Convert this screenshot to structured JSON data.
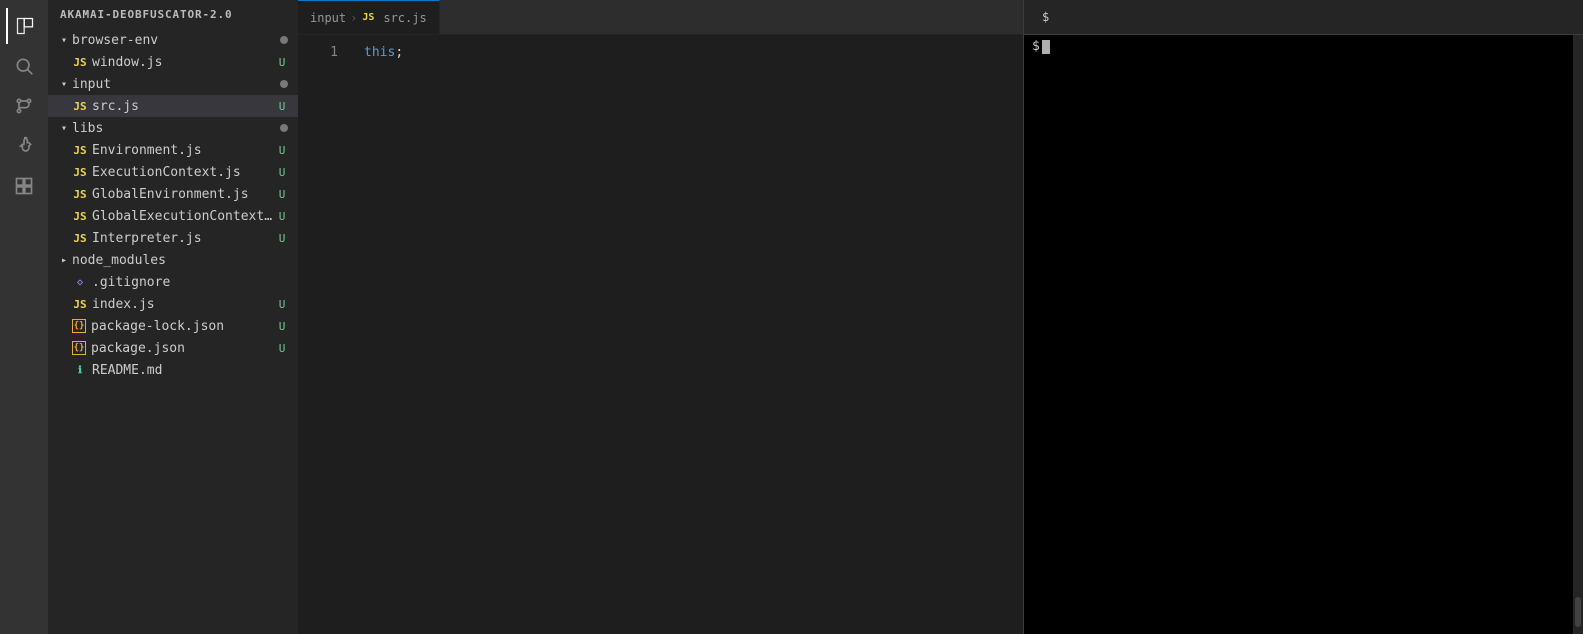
{
  "app": {
    "title": "AKAMAI-DEOBFUSCATOR-2.0"
  },
  "sidebar": {
    "header": "AKAMAI-DEOBFUSCATOR-2.0",
    "items": [
      {
        "id": "browser-env",
        "type": "folder",
        "label": "browser-env",
        "depth": 0,
        "expanded": true,
        "badge": "dot"
      },
      {
        "id": "window-js",
        "type": "js",
        "label": "window.js",
        "depth": 1,
        "badge": "U"
      },
      {
        "id": "input",
        "type": "folder",
        "label": "input",
        "depth": 0,
        "expanded": true,
        "badge": "dot"
      },
      {
        "id": "src-js",
        "type": "js",
        "label": "src.js",
        "depth": 1,
        "badge": "U",
        "active": true
      },
      {
        "id": "libs",
        "type": "folder",
        "label": "libs",
        "depth": 0,
        "expanded": true,
        "badge": "dot"
      },
      {
        "id": "environment-js",
        "type": "js",
        "label": "Environment.js",
        "depth": 1,
        "badge": "U"
      },
      {
        "id": "executioncontext-js",
        "type": "js",
        "label": "ExecutionContext.js",
        "depth": 1,
        "badge": "U"
      },
      {
        "id": "globalenvironment-js",
        "type": "js",
        "label": "GlobalEnvironment.js",
        "depth": 1,
        "badge": "U"
      },
      {
        "id": "globalexecutioncontext-js",
        "type": "js",
        "label": "GlobalExecutionContext.js",
        "depth": 1,
        "badge": "U"
      },
      {
        "id": "interpreter-js",
        "type": "js",
        "label": "Interpreter.js",
        "depth": 1,
        "badge": "U"
      },
      {
        "id": "node-modules",
        "type": "folder",
        "label": "node_modules",
        "depth": 0,
        "expanded": false,
        "badge": ""
      },
      {
        "id": "gitignore",
        "type": "git",
        "label": ".gitignore",
        "depth": 0,
        "badge": ""
      },
      {
        "id": "index-js",
        "type": "js",
        "label": "index.js",
        "depth": 0,
        "badge": "U"
      },
      {
        "id": "package-lock-json",
        "type": "json",
        "label": "package-lock.json",
        "depth": 0,
        "badge": "U"
      },
      {
        "id": "package-json",
        "type": "json",
        "label": "package.json",
        "depth": 0,
        "badge": "U"
      },
      {
        "id": "readme-md",
        "type": "md",
        "label": "README.md",
        "depth": 0,
        "badge": ""
      }
    ]
  },
  "editor": {
    "tabs": [
      {
        "id": "src-js-tab",
        "breadcrumb": [
          "input",
          "src.js"
        ],
        "active": true
      }
    ],
    "lines": [
      {
        "num": 1,
        "content": "this;"
      }
    ]
  },
  "terminal": {
    "title": "$",
    "prompt": "$",
    "cursor": true
  }
}
